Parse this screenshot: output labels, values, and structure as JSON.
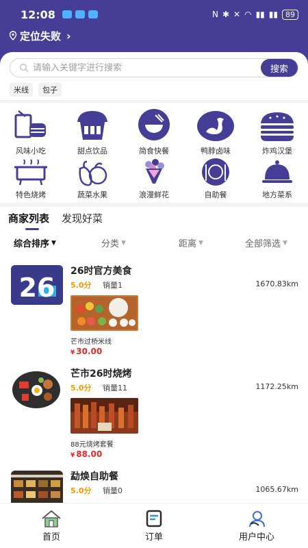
{
  "status": {
    "time": "12:08",
    "battery": "89"
  },
  "location": {
    "label": "定位失败"
  },
  "search": {
    "placeholder": "请输入关键字进行搜索",
    "button": "搜索"
  },
  "hot_tags": [
    "米线",
    "包子"
  ],
  "categories": [
    {
      "label": "风味小吃",
      "icon": "snack-icon"
    },
    {
      "label": "甜点饮品",
      "icon": "dessert-icon"
    },
    {
      "label": "简食快餐",
      "icon": "fast-food-bowl-icon"
    },
    {
      "label": "鸭脖卤味",
      "icon": "duck-icon"
    },
    {
      "label": "炸鸡汉堡",
      "icon": "burger-icon"
    },
    {
      "label": "特色烧烤",
      "icon": "grill-icon"
    },
    {
      "label": "蔬菜水果",
      "icon": "vegetable-icon"
    },
    {
      "label": "浪漫鲜花",
      "icon": "flower-icon"
    },
    {
      "label": "自助餐",
      "icon": "buffet-icon"
    },
    {
      "label": "地方菜系",
      "icon": "cloche-icon"
    }
  ],
  "tabs": [
    {
      "label": "商家列表",
      "active": true
    },
    {
      "label": "发现好菜",
      "active": false
    }
  ],
  "filters": [
    {
      "label": "综合排序",
      "active": true
    },
    {
      "label": "分类",
      "active": false
    },
    {
      "label": "距离",
      "active": false
    },
    {
      "label": "全部筛选",
      "active": false
    }
  ],
  "merchants": [
    {
      "name": "26时官方美食",
      "rating": "5.0分",
      "sales": "销量1",
      "distance": "1670.83km",
      "item": "芒市过桥米线",
      "price_symbol": "¥",
      "price": "30.00"
    },
    {
      "name": "芒市26时烧烤",
      "rating": "5.0分",
      "sales": "销量11",
      "distance": "1172.25km",
      "item": "88元烧烤套餐",
      "price_symbol": "¥",
      "price": "88.00"
    },
    {
      "name": "勐焕自助餐",
      "rating": "5.0分",
      "sales": "销量0",
      "distance": "1065.67km"
    }
  ],
  "logo_text": "26",
  "bottom_nav": [
    {
      "label": "首页",
      "icon": "home-icon"
    },
    {
      "label": "订单",
      "icon": "order-icon"
    },
    {
      "label": "用户中心",
      "icon": "user-center-icon"
    }
  ],
  "colors": {
    "brand": "#463e96",
    "rating": "#f39800",
    "price": "#e02b2b"
  }
}
